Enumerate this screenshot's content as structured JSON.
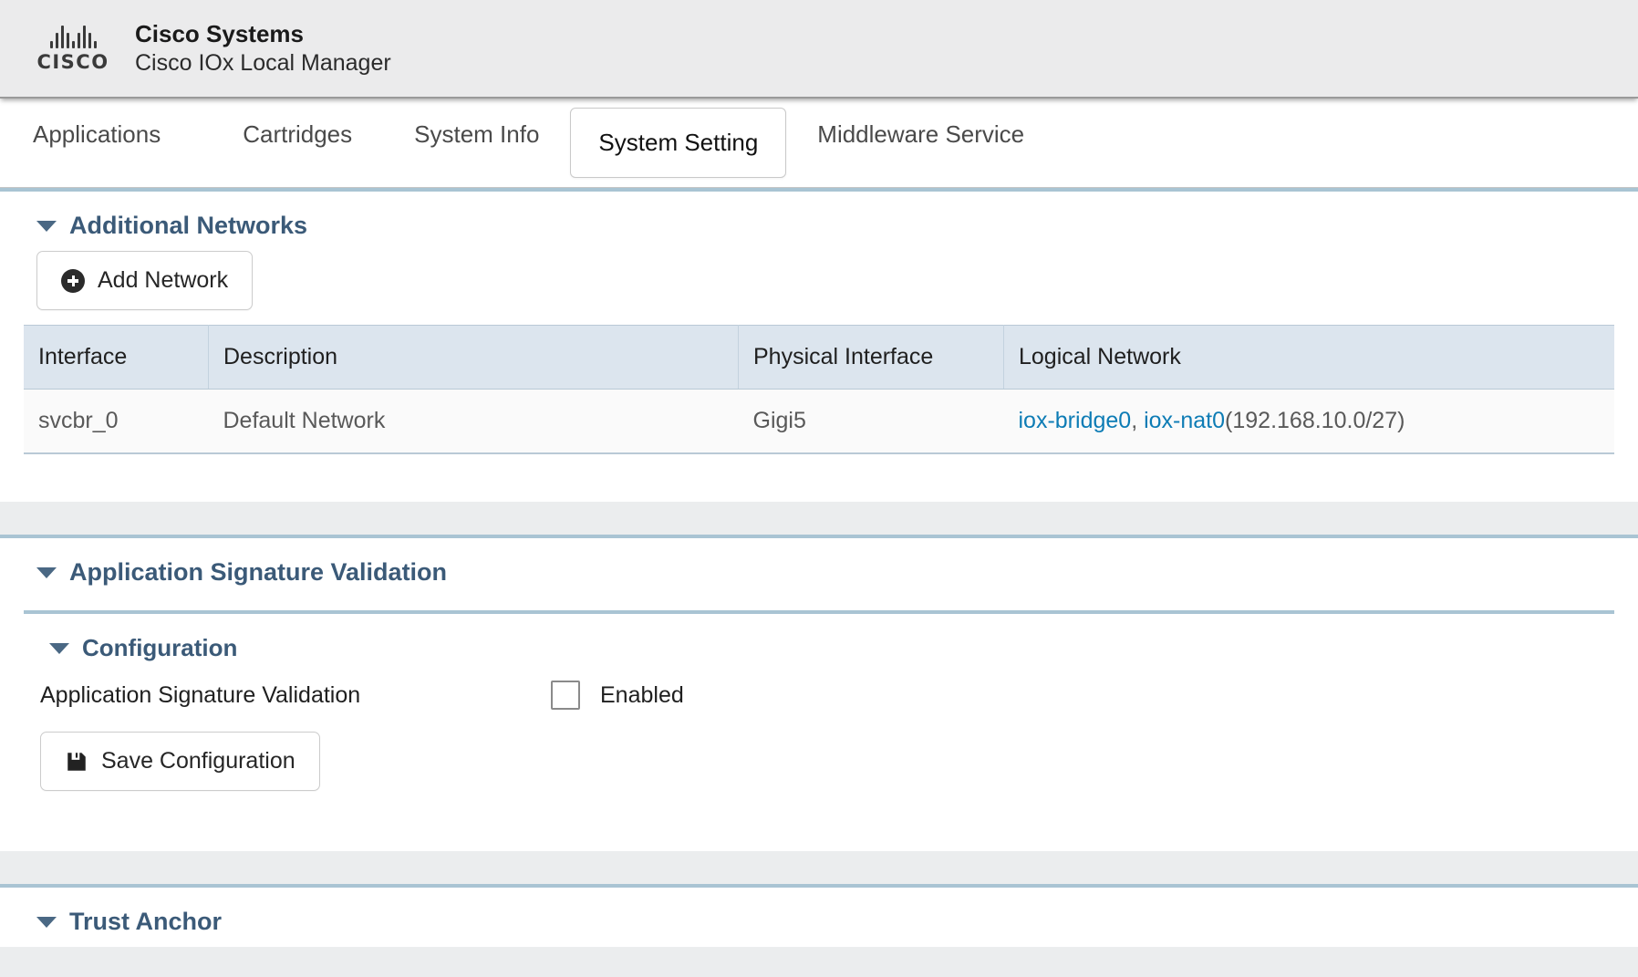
{
  "header": {
    "logo_name": "cisco-logo",
    "logo_wordmark": "CISCO",
    "brand": "Cisco Systems",
    "product": "Cisco IOx Local Manager"
  },
  "tabs": [
    {
      "label": "Applications",
      "active": false
    },
    {
      "label": "Cartridges",
      "active": false
    },
    {
      "label": "System Info",
      "active": false
    },
    {
      "label": "System Setting",
      "active": true
    },
    {
      "label": "Middleware Service",
      "active": false
    }
  ],
  "additional_networks": {
    "title": "Additional Networks",
    "add_button": "Add Network",
    "columns": [
      "Interface",
      "Description",
      "Physical Interface",
      "Logical Network"
    ],
    "rows": [
      {
        "interface": "svcbr_0",
        "description": "Default Network",
        "physical_interface": "Gigi5",
        "logical_network": {
          "links": [
            "iox-bridge0",
            "iox-nat0"
          ],
          "separator": ", ",
          "subnet": "(192.168.10.0/27)"
        }
      }
    ]
  },
  "app_signature_validation": {
    "title": "Application Signature Validation",
    "configuration": {
      "title": "Configuration",
      "row_label": "Application Signature Validation",
      "checkbox_label": "Enabled",
      "checkbox_checked": false,
      "save_button": "Save Configuration"
    }
  },
  "trust_anchor": {
    "title": "Trust Anchor"
  },
  "colors": {
    "accent_link": "#0d7cb5",
    "section_title": "#3b5a78",
    "panel_top_border": "#a9c4d3",
    "table_header_bg": "#dce5ee",
    "page_bg": "#ebedee"
  }
}
